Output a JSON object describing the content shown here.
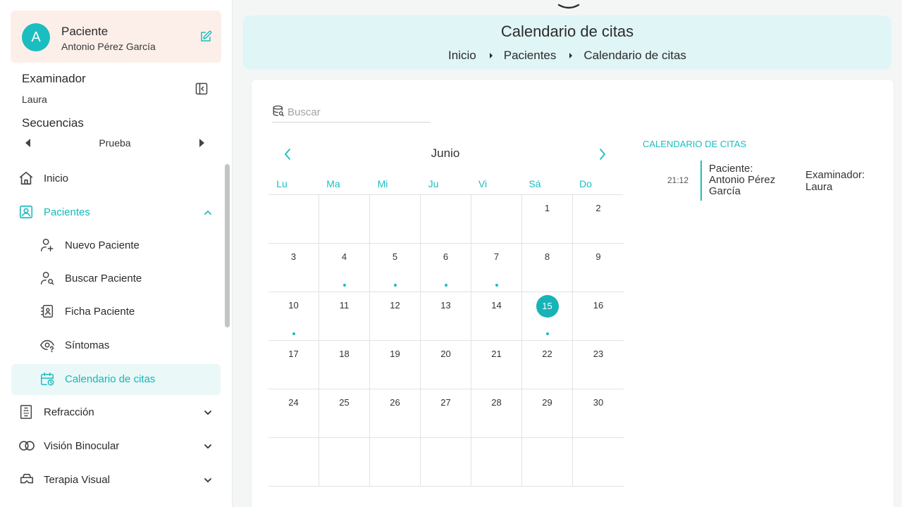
{
  "patient_card": {
    "avatar_letter": "A",
    "title": "Paciente",
    "name": "Antonio Pérez García"
  },
  "examiner": {
    "title": "Examinador",
    "value": "Laura"
  },
  "sequences": {
    "title": "Secuencias",
    "value": "Prueba"
  },
  "nav": {
    "inicio": "Inicio",
    "pacientes": "Pacientes",
    "nuevo_paciente": "Nuevo Paciente",
    "buscar_paciente": "Buscar Paciente",
    "ficha_paciente": "Ficha Paciente",
    "sintomas": "Síntomas",
    "calendario": "Calendario de citas",
    "refraccion": "Refracción",
    "vision_binocular": "Visión Binocular",
    "terapia_visual": "Terapia Visual"
  },
  "header": {
    "title": "Calendario de citas",
    "breadcrumb": [
      "Inicio",
      "Pacientes",
      "Calendario de citas"
    ]
  },
  "search": {
    "placeholder": "Buscar"
  },
  "calendar": {
    "month": "Junio",
    "weekdays": [
      "Lu",
      "Ma",
      "Mi",
      "Ju",
      "Vi",
      "Sá",
      "Do"
    ],
    "weeks": [
      [
        "",
        "",
        "",
        "",
        "",
        "1",
        "2"
      ],
      [
        "3",
        "4",
        "5",
        "6",
        "7",
        "8",
        "9"
      ],
      [
        "10",
        "11",
        "12",
        "13",
        "14",
        "15",
        "16"
      ],
      [
        "17",
        "18",
        "19",
        "20",
        "21",
        "22",
        "23"
      ],
      [
        "24",
        "25",
        "26",
        "27",
        "28",
        "29",
        "30"
      ],
      [
        "",
        "",
        "",
        "",
        "",
        "",
        ""
      ]
    ],
    "selected_day": "15",
    "days_with_events": [
      "4",
      "5",
      "6",
      "7",
      "10",
      "15"
    ]
  },
  "events": {
    "heading": "CALENDARIO DE CITAS",
    "items": [
      {
        "time": "21:12",
        "patient": "Paciente: Antonio Pérez García",
        "examiner": "Examinador: Laura"
      }
    ]
  },
  "colors": {
    "accent": "#1bbdc0",
    "header_bg": "#e0f5f6",
    "patient_card_bg": "#fcefe9",
    "active_bg": "#eaf8f8"
  }
}
